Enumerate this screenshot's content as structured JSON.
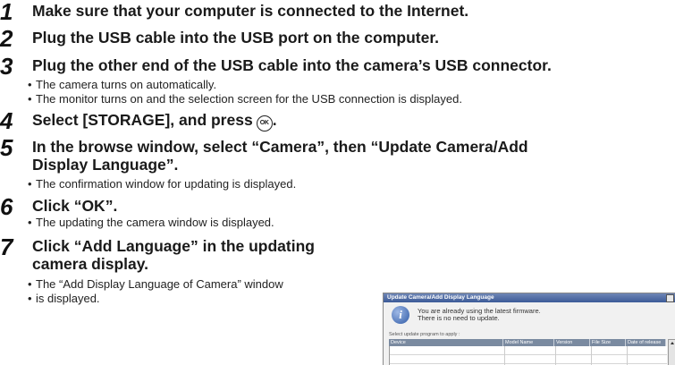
{
  "steps": [
    {
      "num": "1",
      "title": "Make sure that your computer is connected to the Internet.",
      "bullets": []
    },
    {
      "num": "2",
      "title": "Plug the USB cable into the USB port on the computer.",
      "bullets": []
    },
    {
      "num": "3",
      "title": "Plug the other end of the USB cable into the camera’s USB connector.",
      "bullets": [
        "The camera turns on automatically.",
        "The monitor turns on and the selection screen for the USB connection is displayed."
      ]
    },
    {
      "num": "4",
      "title": "Select [STORAGE], and press",
      "bullets": []
    },
    {
      "num": "5",
      "title": "In the browse window, select “Camera”, then “Update Camera/Add",
      "title_line2": "Display Language”.",
      "bullets": [
        "The confirmation window for updating is displayed."
      ]
    },
    {
      "num": "6",
      "title": "Click “OK”.",
      "bullets": [
        "The updating the camera window is displayed."
      ]
    },
    {
      "num": "7",
      "title": "Click “Add Language” in the updating",
      "title_line2": "camera display.",
      "bullets": [
        "The “Add Display Language of Camera” window",
        "is displayed."
      ]
    }
  ],
  "ok_button_icon": {
    "icon": "ok-button-icon",
    "label": "OK"
  },
  "dialog": {
    "title": "Update Camera/Add Display Language",
    "message_line1": "You are already using the latest firmware.",
    "message_line2": "There is no need to update.",
    "select_label": "Select update program to apply :",
    "columns": [
      "Device",
      "Model Name",
      "Version",
      "File Size",
      "Date of release"
    ]
  }
}
